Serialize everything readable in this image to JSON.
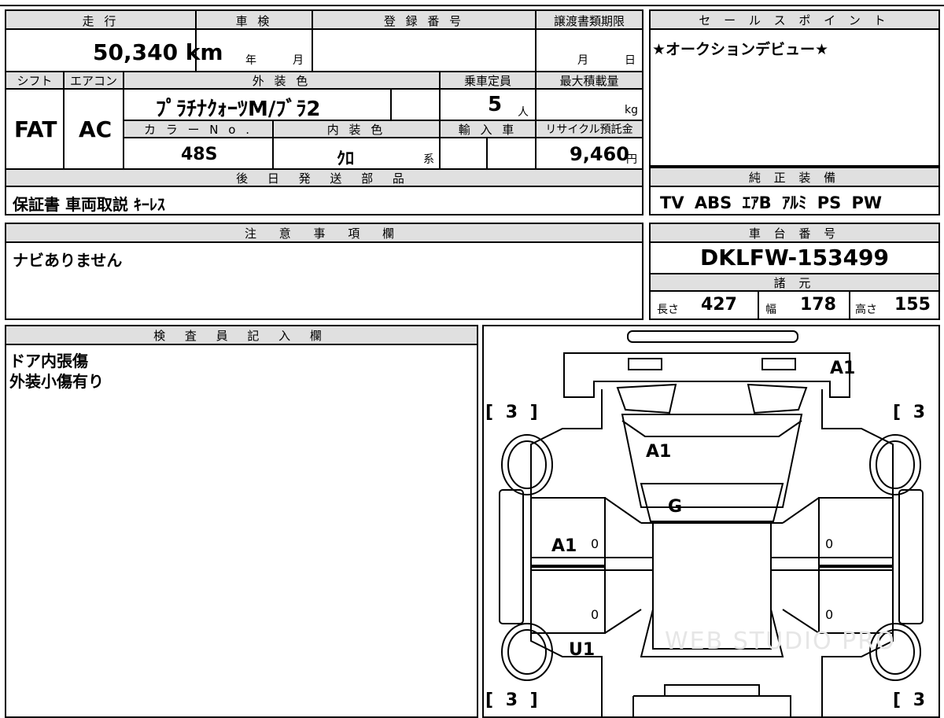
{
  "mileage": {
    "header": "走 行",
    "value": "50,340 km"
  },
  "inspection": {
    "header": "車 検",
    "year_unit": "年",
    "month_unit": "月"
  },
  "registration": {
    "header": "登 録 番 号"
  },
  "transfer": {
    "header": "譲渡書類期限",
    "month_unit": "月",
    "day_unit": "日"
  },
  "shift": {
    "header": "シフト",
    "value": "FAT"
  },
  "aircon": {
    "header": "エアコン",
    "value": "AC"
  },
  "exterior_color": {
    "header": "外 装 色",
    "value": "ﾌﾟﾗﾁﾅｸｫｰﾂM/ﾌﾞﾗ2"
  },
  "capacity": {
    "header": "乗車定員",
    "value": "5",
    "unit": "人"
  },
  "max_load": {
    "header": "最大積載量",
    "unit": "kg"
  },
  "color_no": {
    "header": "カ ラ ー N o .",
    "value": "48S"
  },
  "interior_color": {
    "header": "内 装 色",
    "value": "ｸﾛ",
    "suffix": "系"
  },
  "import": {
    "header": "輸 入 車"
  },
  "recycle": {
    "header": "リサイクル預託金",
    "value": "9,460",
    "unit": "円"
  },
  "later_parts": {
    "header": "後 日 発 送 部 品",
    "value": "保証書 車両取説 ｷｰﾚｽ"
  },
  "sales_point": {
    "header": "セ ー ル ス ポ イ ン ト",
    "value": "★オークションデビュー★"
  },
  "equipment": {
    "header": "純 正 装 備",
    "value": "TV ABS ｴｱB ｱﾙﾐ PS PW"
  },
  "notes": {
    "header": "注 意 事 項 欄",
    "value": "ナビありません"
  },
  "chassis": {
    "header": "車 台 番 号",
    "value": "DKLFW-153499"
  },
  "specs": {
    "header": "諸 元",
    "length_label": "長さ",
    "length": "427",
    "width_label": "幅",
    "width": "178",
    "height_label": "高さ",
    "height": "155"
  },
  "inspector": {
    "header": "検 査 員 記 入 欄",
    "lines": [
      "ドア内張傷",
      "外装小傷有り"
    ]
  },
  "diagram": {
    "marks": [
      "A1",
      "A1",
      "G",
      "A1",
      "U1"
    ],
    "tires": [
      "[ 3 ]",
      "[ 3 ]",
      "[ 3 ]",
      "[ 3 ]"
    ],
    "zeros": [
      "0",
      "0",
      "0",
      "0"
    ],
    "watermark": "WEB STUDIO PRO"
  }
}
